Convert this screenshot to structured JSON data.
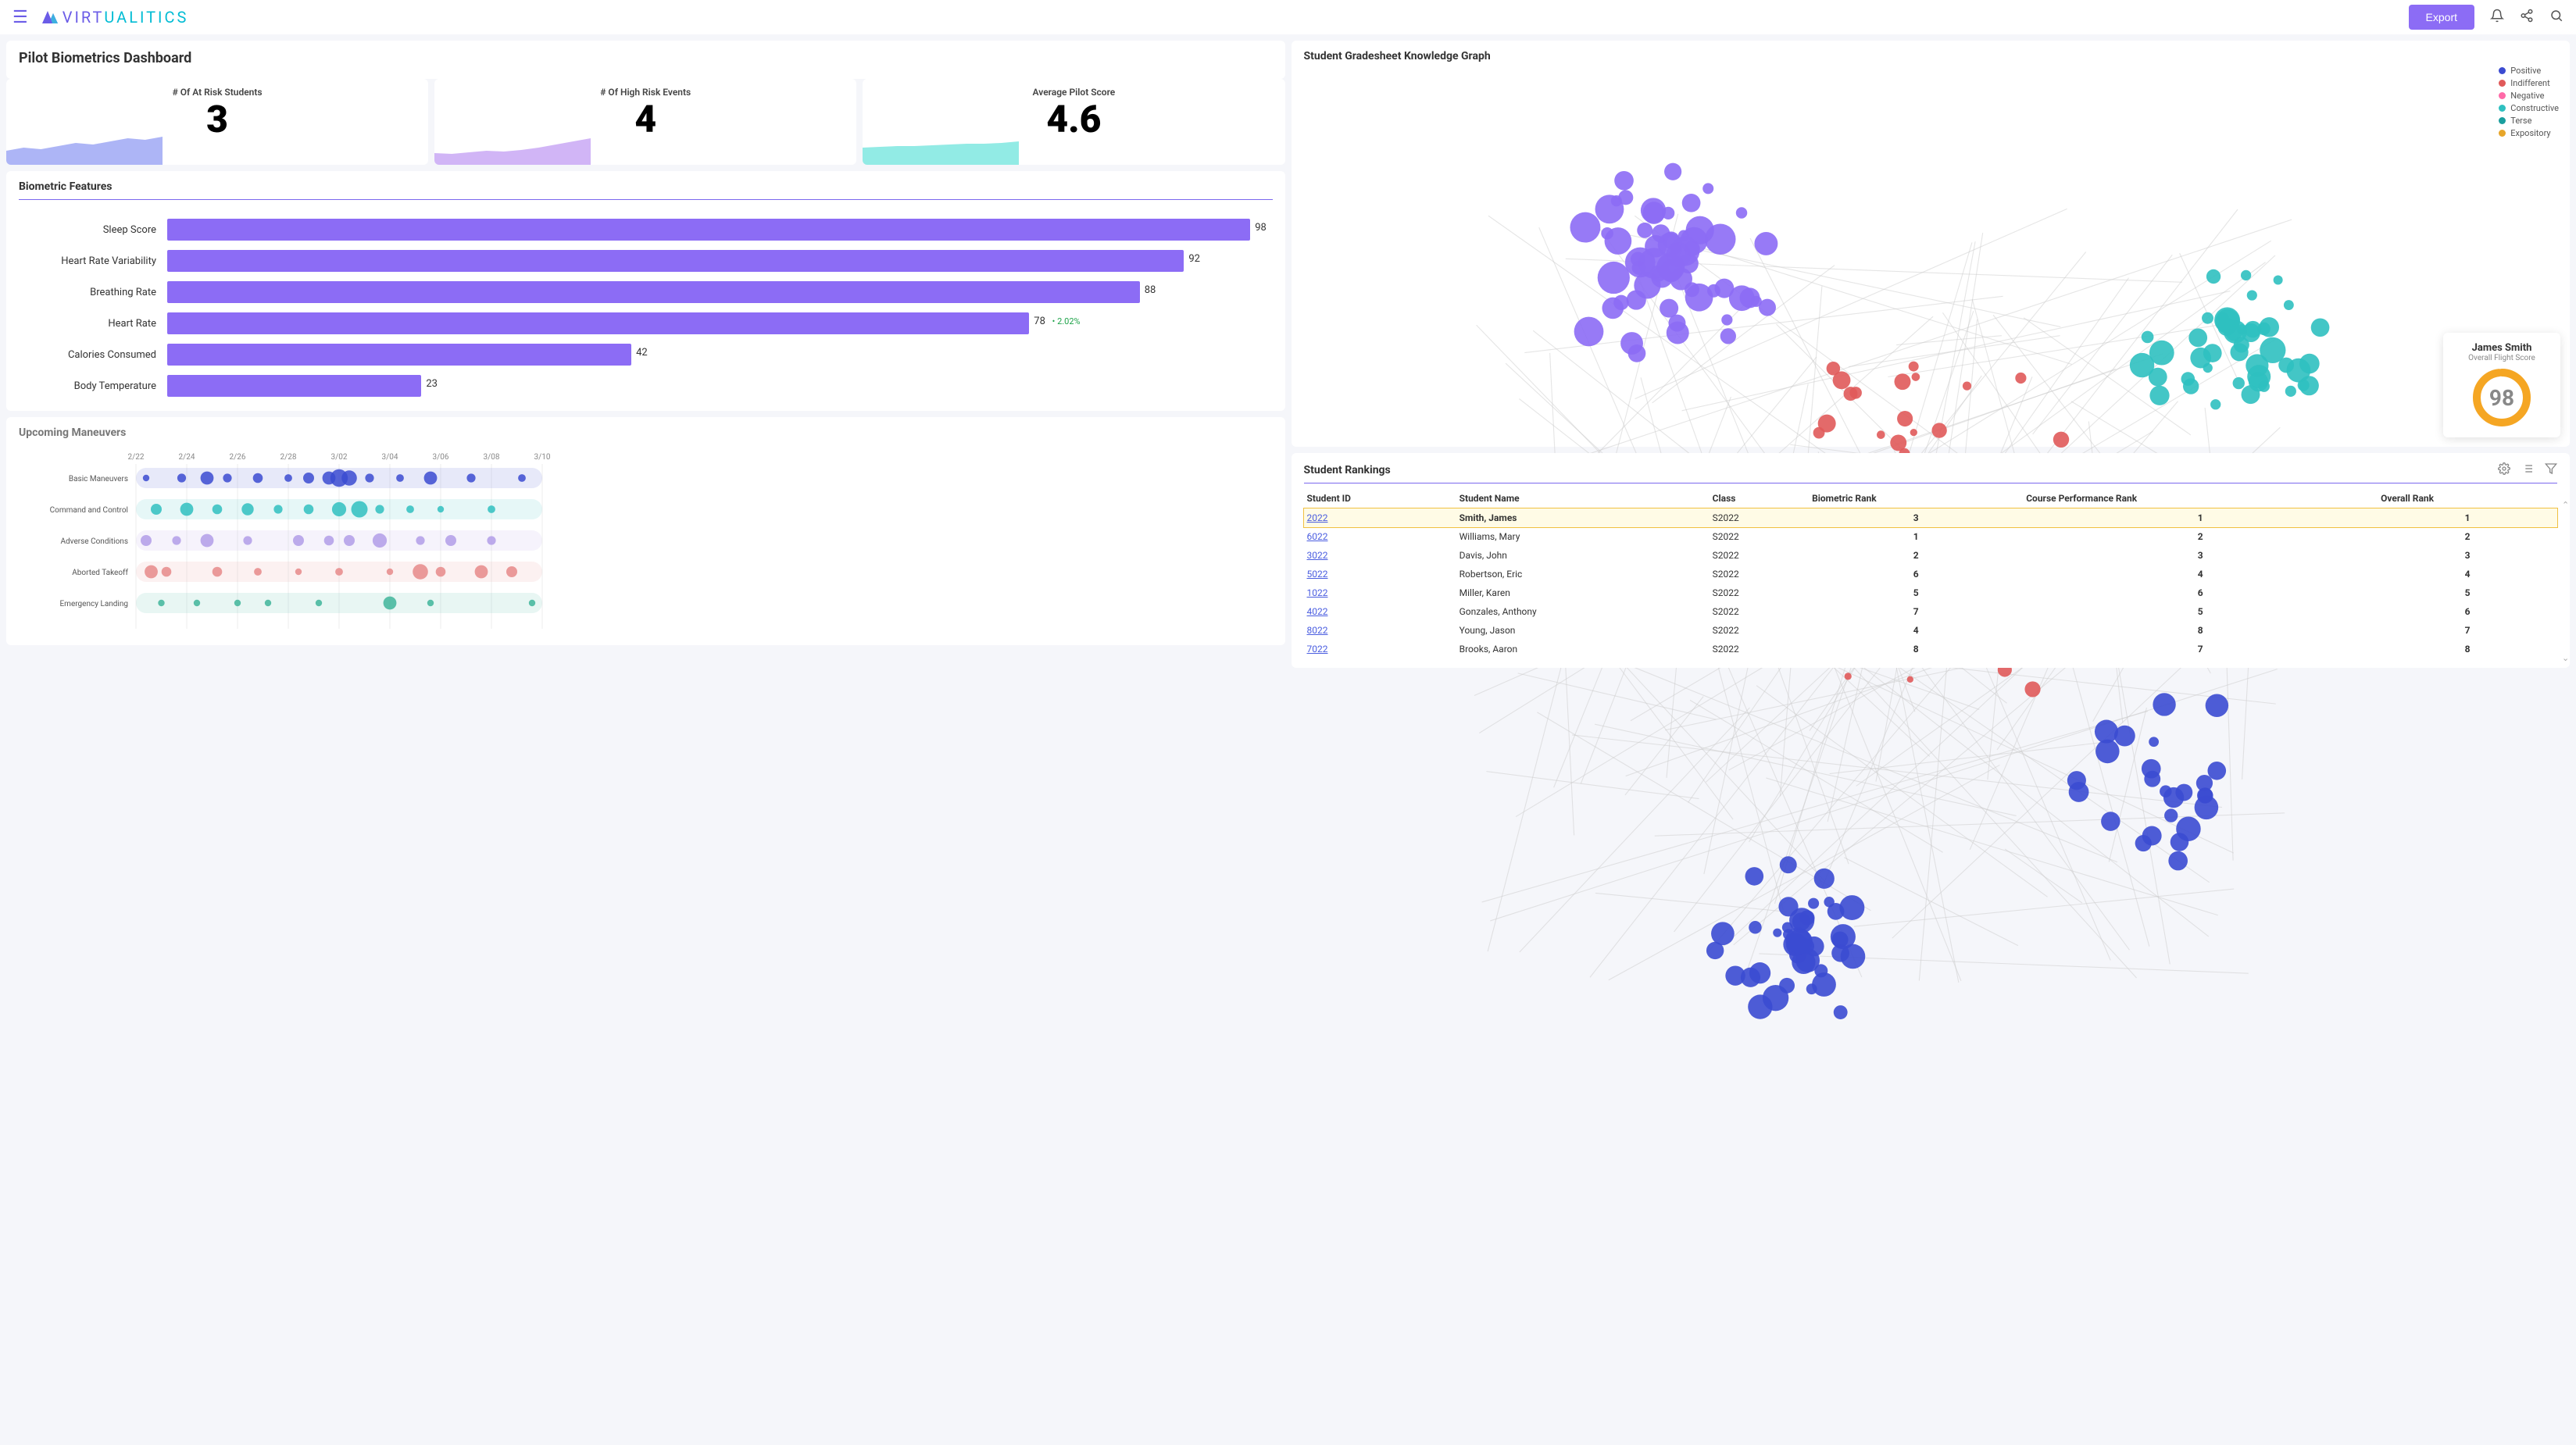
{
  "header": {
    "brand_virt": "VIRT",
    "brand_rest": "UALITICS",
    "export_label": "Export"
  },
  "dashboard_title": "Pilot Biometrics Dashboard",
  "kpis": [
    {
      "label": "# Of At Risk Students",
      "value": "3",
      "color": "#9fa8f5"
    },
    {
      "label": "# Of High Risk Events",
      "value": "4",
      "color": "#c9a8f5"
    },
    {
      "label": "Average Pilot Score",
      "value": "4.6",
      "color": "#7fe8e0"
    }
  ],
  "features_title": "Biometric Features",
  "graph_title": "Student Gradesheet Knowledge Graph",
  "legend": [
    {
      "label": "Positive",
      "color": "#3b4bd1"
    },
    {
      "label": "Indifferent",
      "color": "#e05a5a"
    },
    {
      "label": "Negative",
      "color": "#ff6aa8"
    },
    {
      "label": "Constructive",
      "color": "#2fc0c0"
    },
    {
      "label": "Terse",
      "color": "#1a9e9e"
    },
    {
      "label": "Expository",
      "color": "#e7a62a"
    }
  ],
  "score_card": {
    "name": "James Smith",
    "subtitle": "Overall Flight Score",
    "value": "98",
    "pct": 98
  },
  "maneuvers_title": "Upcoming Maneuvers",
  "rankings_title": "Student Rankings",
  "rankings_headers": [
    "Student ID",
    "Student Name",
    "Class",
    "Biometric Rank",
    "Course Performance Rank",
    "Overall Rank"
  ],
  "rankings_rows": [
    {
      "id": "2022",
      "name": "Smith, James",
      "cls": "S2022",
      "bio": "3",
      "perf": "1",
      "overall": "1",
      "sel": true,
      "bold": true
    },
    {
      "id": "6022",
      "name": "Williams, Mary",
      "cls": "S2022",
      "bio": "1",
      "perf": "2",
      "overall": "2"
    },
    {
      "id": "3022",
      "name": "Davis, John",
      "cls": "S2022",
      "bio": "2",
      "perf": "3",
      "overall": "3"
    },
    {
      "id": "5022",
      "name": "Robertson, Eric",
      "cls": "S2022",
      "bio": "6",
      "perf": "4",
      "overall": "4"
    },
    {
      "id": "1022",
      "name": "Miller, Karen",
      "cls": "S2022",
      "bio": "5",
      "perf": "6",
      "overall": "5"
    },
    {
      "id": "4022",
      "name": "Gonzales, Anthony",
      "cls": "S2022",
      "bio": "7",
      "perf": "5",
      "overall": "6"
    },
    {
      "id": "8022",
      "name": "Young, Jason",
      "cls": "S2022",
      "bio": "4",
      "perf": "8",
      "overall": "7"
    },
    {
      "id": "7022",
      "name": "Brooks, Aaron",
      "cls": "S2022",
      "bio": "8",
      "perf": "7",
      "overall": "8"
    }
  ],
  "chart_data": [
    {
      "type": "bar",
      "title": "Biometric Features",
      "orientation": "horizontal",
      "categories": [
        "Sleep Score",
        "Heart Rate Variability",
        "Breathing Rate",
        "Heart Rate",
        "Calories Consumed",
        "Body Temperature"
      ],
      "values": [
        98,
        92,
        88,
        78,
        42,
        23
      ],
      "annotations": {
        "Heart Rate": "2.02%"
      },
      "xlim": [
        0,
        100
      ],
      "color": "#8c6cf5"
    },
    {
      "type": "area",
      "title": "# Of At Risk Students sparkline",
      "x": [
        0,
        1,
        2,
        3,
        4,
        5,
        6,
        7,
        8,
        9
      ],
      "values": [
        18,
        22,
        20,
        24,
        28,
        26,
        30,
        34,
        32,
        36
      ],
      "color": "#9fa8f5"
    },
    {
      "type": "area",
      "title": "# Of High Risk Events sparkline",
      "x": [
        0,
        1,
        2,
        3,
        4,
        5,
        6,
        7,
        8,
        9
      ],
      "values": [
        15,
        14,
        16,
        18,
        17,
        19,
        22,
        26,
        30,
        34
      ],
      "color": "#c9a8f5"
    },
    {
      "type": "area",
      "title": "Average Pilot Score sparkline",
      "x": [
        0,
        1,
        2,
        3,
        4,
        5,
        6,
        7,
        8,
        9
      ],
      "values": [
        22,
        23,
        24,
        24,
        25,
        26,
        27,
        27,
        28,
        30
      ],
      "color": "#7fe8e0"
    },
    {
      "type": "scatter",
      "title": "Upcoming Maneuvers",
      "x_ticks": [
        "2/22",
        "2/24",
        "2/26",
        "2/28",
        "3/02",
        "3/04",
        "3/06",
        "3/08",
        "3/10"
      ],
      "y_categories": [
        "Basic Maneuvers",
        "Command and Control",
        "Adverse Conditions",
        "Aborted Takeoff",
        "Emergency Landing"
      ],
      "series": [
        {
          "name": "Basic Maneuvers",
          "color": "#3b4bd1",
          "points": [
            [
              0.2,
              6
            ],
            [
              0.9,
              8
            ],
            [
              1.4,
              12
            ],
            [
              1.8,
              8
            ],
            [
              2.4,
              9
            ],
            [
              3.0,
              7
            ],
            [
              3.4,
              10
            ],
            [
              3.8,
              12
            ],
            [
              4.0,
              16
            ],
            [
              4.2,
              14
            ],
            [
              4.6,
              8
            ],
            [
              5.2,
              7
            ],
            [
              5.8,
              12
            ],
            [
              6.6,
              8
            ],
            [
              7.6,
              7
            ]
          ]
        },
        {
          "name": "Command and Control",
          "color": "#2fc0c0",
          "points": [
            [
              0.4,
              10
            ],
            [
              1.0,
              12
            ],
            [
              1.6,
              9
            ],
            [
              2.2,
              11
            ],
            [
              2.8,
              8
            ],
            [
              3.4,
              9
            ],
            [
              4.0,
              13
            ],
            [
              4.4,
              15
            ],
            [
              4.8,
              8
            ],
            [
              5.4,
              7
            ],
            [
              6.0,
              6
            ],
            [
              7.0,
              7
            ]
          ]
        },
        {
          "name": "Adverse Conditions",
          "color": "#b29ce8",
          "points": [
            [
              0.2,
              10
            ],
            [
              0.8,
              8
            ],
            [
              1.4,
              12
            ],
            [
              2.2,
              8
            ],
            [
              3.2,
              10
            ],
            [
              3.8,
              9
            ],
            [
              4.2,
              10
            ],
            [
              4.8,
              13
            ],
            [
              5.6,
              8
            ],
            [
              6.2,
              10
            ],
            [
              7.0,
              8
            ]
          ]
        },
        {
          "name": "Aborted Takeoff",
          "color": "#e68a8a",
          "points": [
            [
              0.3,
              12
            ],
            [
              0.6,
              9
            ],
            [
              1.6,
              9
            ],
            [
              2.4,
              7
            ],
            [
              3.2,
              6
            ],
            [
              4.0,
              7
            ],
            [
              5.0,
              6
            ],
            [
              5.6,
              14
            ],
            [
              6.0,
              9
            ],
            [
              6.8,
              12
            ],
            [
              7.4,
              10
            ]
          ]
        },
        {
          "name": "Emergency Landing",
          "color": "#3fb59a",
          "points": [
            [
              0.5,
              6
            ],
            [
              1.2,
              6
            ],
            [
              2.0,
              6
            ],
            [
              2.6,
              6
            ],
            [
              3.6,
              6
            ],
            [
              5.0,
              12
            ],
            [
              5.8,
              6
            ],
            [
              7.8,
              6
            ]
          ]
        }
      ]
    }
  ]
}
